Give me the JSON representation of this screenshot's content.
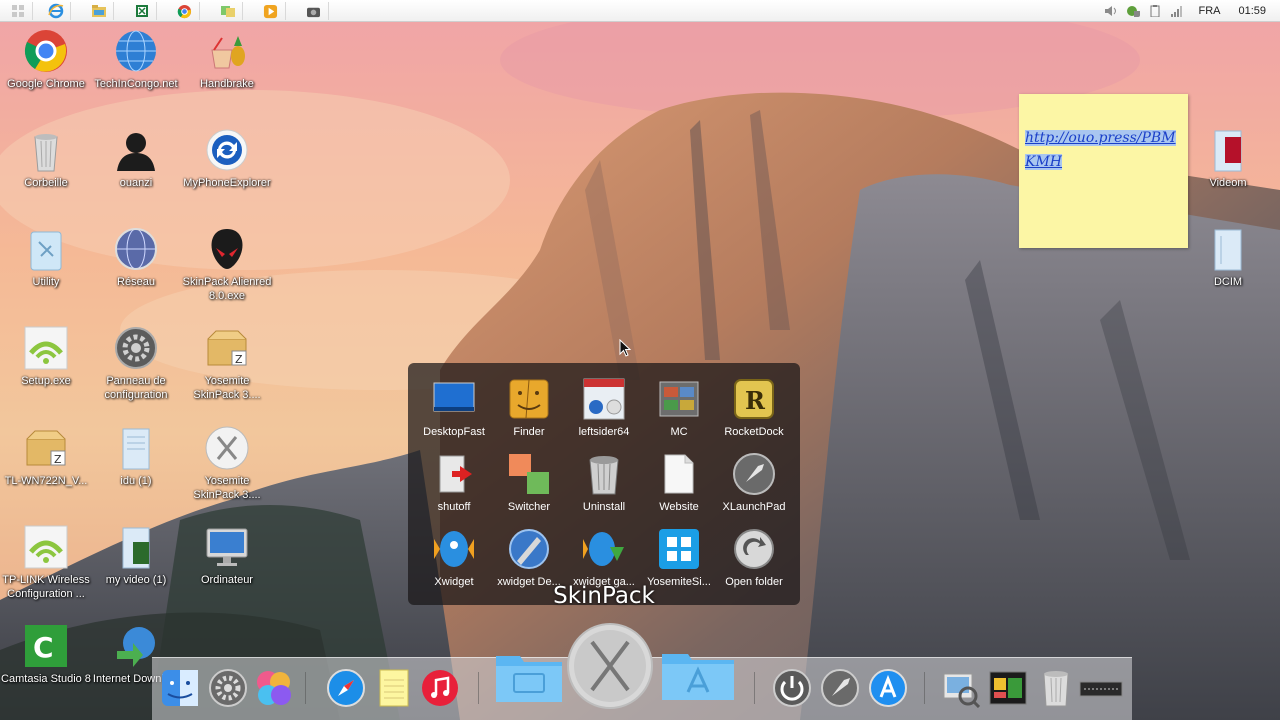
{
  "taskbar": {
    "quick_launch": [
      "start",
      "internet-explorer",
      "file-explorer",
      "excel",
      "chrome",
      "folder-app",
      "media-player",
      "camera"
    ],
    "language": "FRA",
    "clock": "01:59"
  },
  "desktop_icons": [
    {
      "label": "Google Chrome"
    },
    {
      "label": "TechInCongo.net"
    },
    {
      "label": "Handbrake"
    },
    {
      "label": "Corbeille"
    },
    {
      "label": "ouanzi"
    },
    {
      "label": "MyPhoneExplorer"
    },
    {
      "label": "Utility"
    },
    {
      "label": "Réseau"
    },
    {
      "label": "SkinPack Alienred 8.0.exe"
    },
    {
      "label": "Setup.exe"
    },
    {
      "label": "Panneau de configuration"
    },
    {
      "label": "Yosemite SkinPack 3...."
    },
    {
      "label": "TL-WN722N_V..."
    },
    {
      "label": "idu (1)"
    },
    {
      "label": "Yosemite SkinPack 3...."
    },
    {
      "label": "TP-LINK Wireless Configuration ..."
    },
    {
      "label": "my video (1)"
    },
    {
      "label": "Ordinateur"
    },
    {
      "label": "Camtasia Studio 8"
    },
    {
      "label": "Internet Downlo..."
    },
    {
      "label": "Videom"
    },
    {
      "label": "DCIM"
    }
  ],
  "sticky_note": {
    "link": "http://ouo.press/PBMKMH"
  },
  "skinpack_panel": {
    "title": "SkinPack",
    "items": [
      {
        "label": "DesktopFast"
      },
      {
        "label": "Finder"
      },
      {
        "label": "leftsider64"
      },
      {
        "label": "MC"
      },
      {
        "label": "RocketDock"
      },
      {
        "label": "shutoff"
      },
      {
        "label": "Switcher"
      },
      {
        "label": "Uninstall"
      },
      {
        "label": "Website"
      },
      {
        "label": "XLaunchPad"
      },
      {
        "label": "Xwidget"
      },
      {
        "label": "xwidget De..."
      },
      {
        "label": "xwidget ga..."
      },
      {
        "label": "YosemiteSi..."
      },
      {
        "label": "Open folder"
      }
    ]
  },
  "dock": {
    "items": [
      "finder",
      "system-preferences",
      "game-center",
      "safari",
      "notes",
      "itunes",
      "documents-folder",
      "yosemite-x",
      "applications-folder",
      "power",
      "launchpad",
      "app-store",
      "preview",
      "gallery",
      "trash",
      "terminal"
    ]
  }
}
